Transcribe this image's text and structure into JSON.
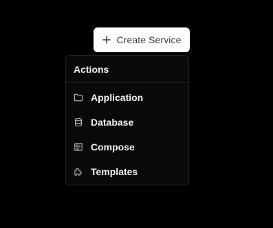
{
  "create_button": {
    "label": "Create Service",
    "icon": "plus-icon"
  },
  "menu": {
    "header": "Actions",
    "items": [
      {
        "label": "Application",
        "icon": "folder-icon"
      },
      {
        "label": "Database",
        "icon": "database-icon"
      },
      {
        "label": "Compose",
        "icon": "compose-icon"
      },
      {
        "label": "Templates",
        "icon": "puzzle-icon"
      }
    ]
  },
  "colors": {
    "background": "#000000",
    "button_bg": "#ffffff",
    "menu_bg": "#09090b",
    "menu_border": "#26262a",
    "text": "#f2f2f2"
  }
}
